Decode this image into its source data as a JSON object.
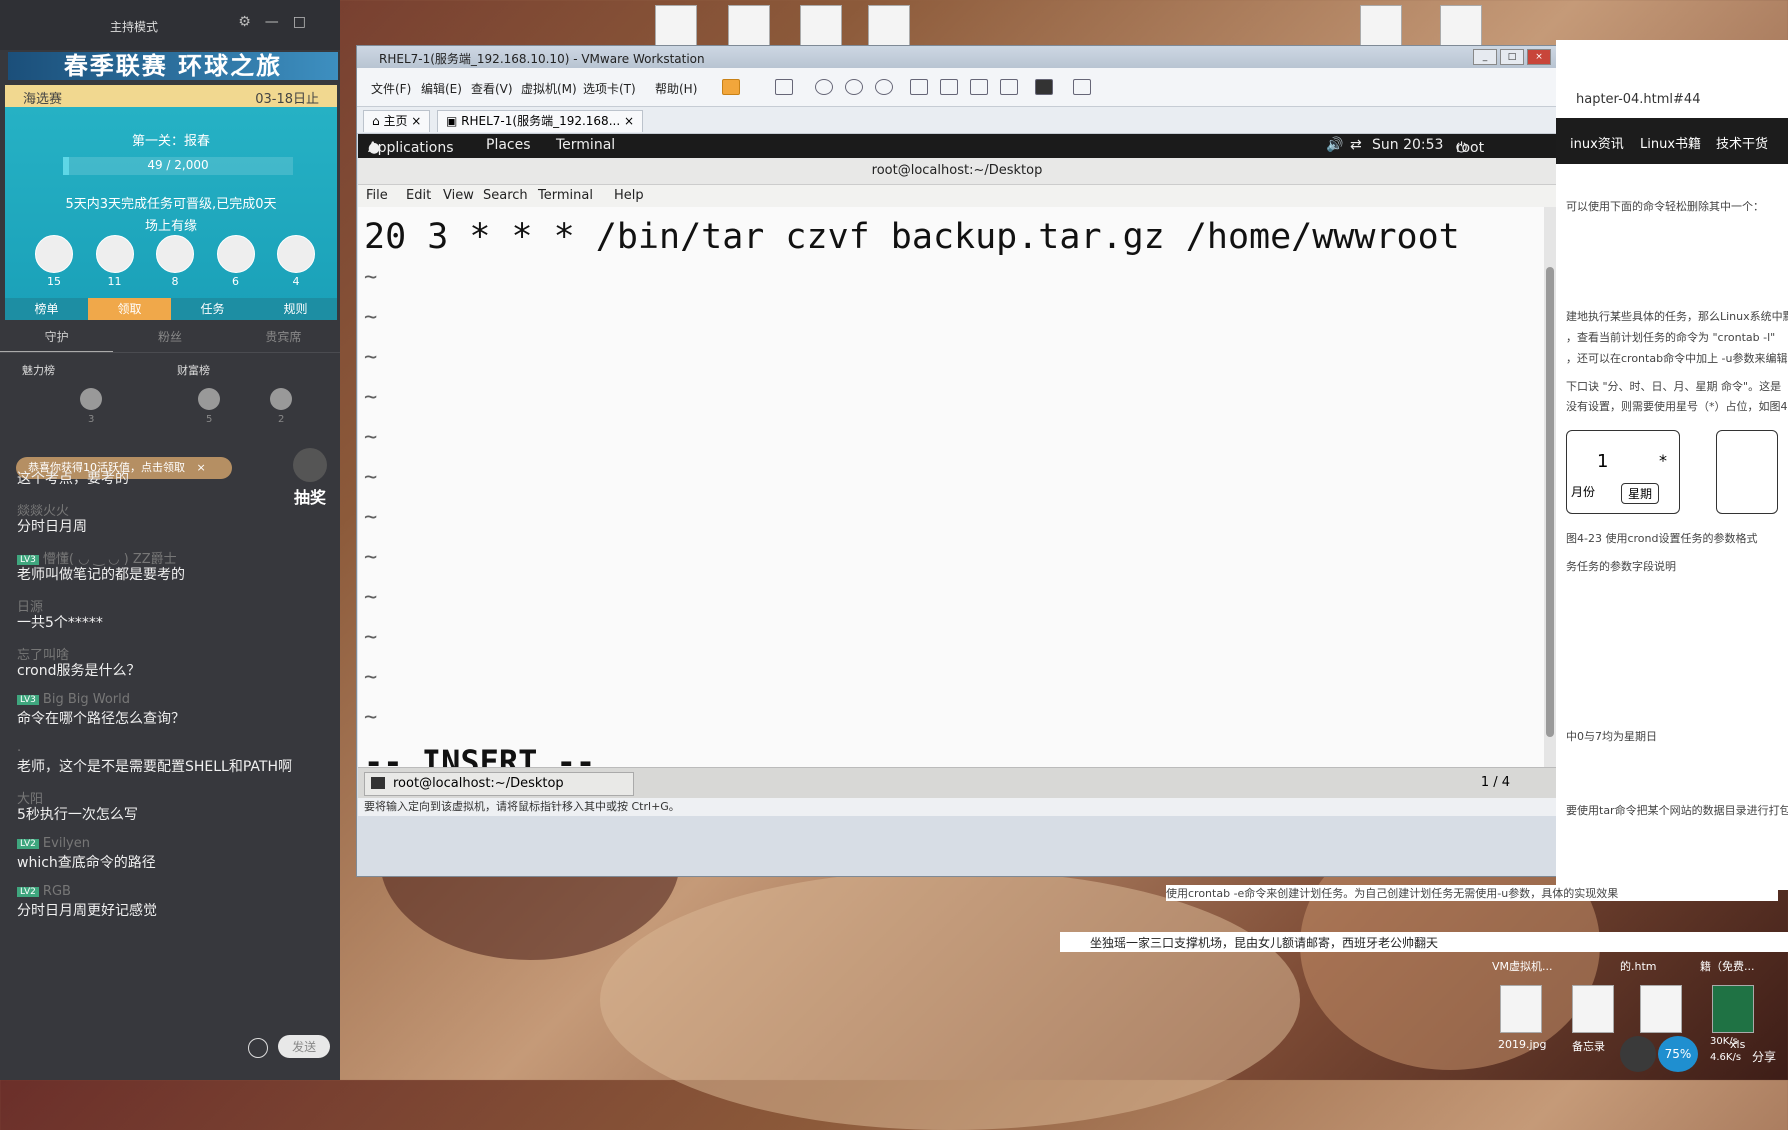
{
  "left_panel": {
    "mode_label": "主持模式",
    "banner": "春季联赛 环球之旅",
    "event": {
      "stage_left": "海选赛",
      "stage_right": "03-18日止",
      "level_title": "第一关：报春",
      "progress_text": "49 / 2,000",
      "progress_fraction": 0.0245,
      "note": "5天内3天完成任务可晋级,已完成0天",
      "sub": "场上有缘",
      "avatar_counts": [
        "15",
        "11",
        "8",
        "6",
        "4"
      ],
      "tabs": [
        "榜单",
        "领取",
        "任务",
        "规则"
      ]
    },
    "tabs": [
      "守护",
      "粉丝",
      "贵宾席"
    ],
    "rank": {
      "charm": "魅力榜",
      "wealth": "财富榜"
    },
    "rank_counts": [
      "3",
      "5",
      "2"
    ],
    "notice": "恭喜你获得10活跃值，点击领取",
    "lottery": "抽奖",
    "chat": [
      {
        "user": "",
        "level": "",
        "text": "这个考点，要考的"
      },
      {
        "user": "燚燚火火",
        "level": "",
        "text": "分时日月周"
      },
      {
        "user": "懵懂( ◡ ‿ ◡ ) ZZ爵士",
        "level": "LV3",
        "text": "老师叫做笔记的都是要考的"
      },
      {
        "user": "日源",
        "level": "",
        "text": "一共5个*****"
      },
      {
        "user": "忘了叫啥",
        "level": "",
        "text": "crond服务是什么？"
      },
      {
        "user": "Big Big World",
        "level": "LV3",
        "text": "命令在哪个路径怎么查询？"
      },
      {
        "user": ".",
        "level": "",
        "text": "老师，这个是不是需要配置SHELL和PATH啊"
      },
      {
        "user": "大阳",
        "level": "",
        "text": "5秒执行一次怎么写"
      },
      {
        "user": "Evilyen",
        "level": "LV2",
        "text": "which查底命令的路径"
      },
      {
        "user": "RGB",
        "level": "LV2",
        "text": "分时日月周更好记感觉"
      }
    ],
    "send_label": "发送"
  },
  "vmware": {
    "title": "RHEL7-1(服务端_192.168.10.10) - VMware Workstation",
    "menu": [
      "文件(F)",
      "编辑(E)",
      "查看(V)",
      "虚拟机(M)",
      "选项卡(T)",
      "帮助(H)"
    ],
    "tabs": [
      "主页",
      "RHEL7-1(服务端_192.168..."
    ],
    "gnome": {
      "applications": "Applications",
      "places": "Places",
      "terminal": "Terminal",
      "clock": "Sun 20:53",
      "user": "root"
    },
    "terminal": {
      "title": "root@localhost:~/Desktop",
      "menu": [
        "File",
        "Edit",
        "View",
        "Search",
        "Terminal",
        "Help"
      ],
      "command": "20 3 * * * /bin/tar czvf backup.tar.gz /home/wwwroot",
      "tilde": "~",
      "mode": "-- INSERT --"
    },
    "taskbar_item": "root@localhost:~/Desktop",
    "page_indicator": "1 / 4",
    "status": "要将输入定向到该虚拟机，请将鼠标指针移入其中或按 Ctrl+G。"
  },
  "browser": {
    "url_fragment": "hapter-04.html#44",
    "nav": [
      "inux资讯",
      "Linux书籍",
      "技术干货"
    ],
    "lines": [
      "可以使用下面的命令轻松删除其中一个：",
      "建地执行某些具体的任务，那么Linux系统中默",
      "，查看当前计划任务的命令为 \"crontab -l\"",
      "，还可以在crontab命令中加上 -u参数来编辑",
      "下口诀 \"分、时、日、月、星期 命令\"。这是",
      "没有设置，则需要使用星号（*）占位，如图4",
      "图4-23  使用crond设置任务的参数格式",
      "务任务的参数字段说明",
      "中0与7均为星期日",
      "要使用tar命令把某个网站的数据目录进行打包",
      "使用crontab -e命令来创建计划任务。为自己创建计划任务无需使用-u参数，具体的实现效果"
    ],
    "diagram": {
      "num": "1",
      "star": "*",
      "box_left": "月份",
      "box_right": "星期"
    }
  },
  "desktop": {
    "news": "坐独瑶一家三口支撑机场，昆由女儿额请邮寄，西班牙老公帅翻天",
    "icons": [
      "VM虚拟机...",
      "的.htm",
      "籍（免费...",
      "2019.jpg",
      "备忘录",
      "xls"
    ],
    "tray": {
      "battery": "75%",
      "up": "30K/s",
      "down": "4.6K/s",
      "share": "分享"
    }
  }
}
